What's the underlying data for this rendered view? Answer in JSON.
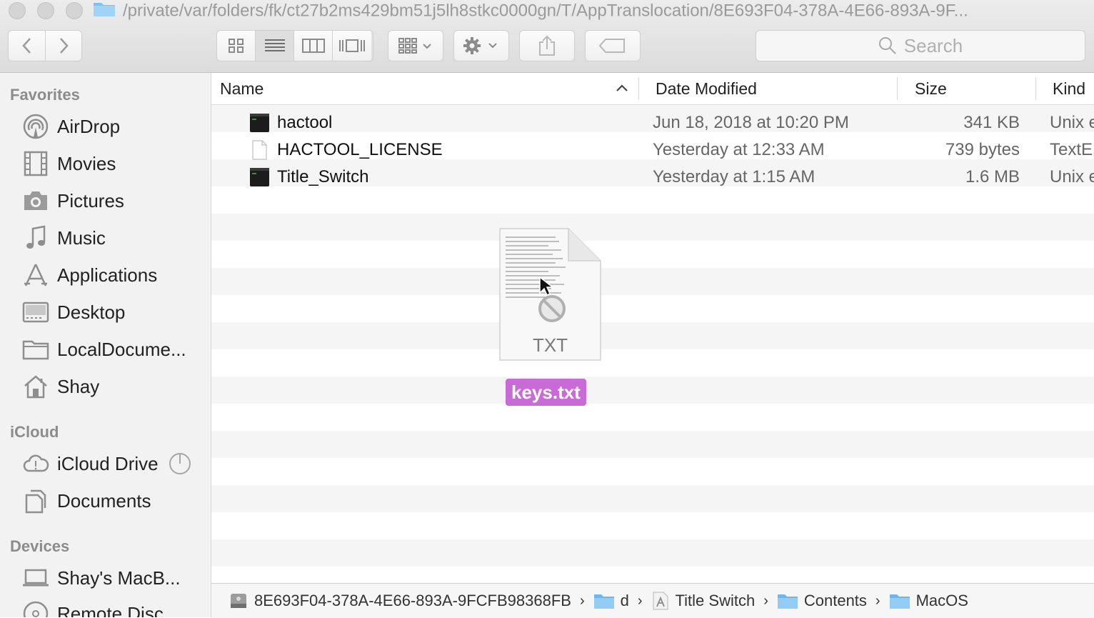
{
  "window": {
    "title_path": "/private/var/folders/fk/ct27b2ms429bm51j5lh8stkc0000gn/T/AppTranslocation/8E693F04-378A-4E66-893A-9F..."
  },
  "toolbar": {
    "search_placeholder": "Search"
  },
  "sidebar": {
    "favorites_header": "Favorites",
    "favorites": [
      {
        "label": "AirDrop",
        "icon": "airdrop-icon"
      },
      {
        "label": "Movies",
        "icon": "film-icon"
      },
      {
        "label": "Pictures",
        "icon": "camera-icon"
      },
      {
        "label": "Music",
        "icon": "music-note-icon"
      },
      {
        "label": "Applications",
        "icon": "applications-icon"
      },
      {
        "label": "Desktop",
        "icon": "desktop-icon"
      },
      {
        "label": "LocalDocume...",
        "icon": "folder-icon"
      },
      {
        "label": "Shay",
        "icon": "home-icon"
      }
    ],
    "icloud_header": "iCloud",
    "icloud": [
      {
        "label": "iCloud Drive",
        "icon": "cloud-icon"
      },
      {
        "label": "Documents",
        "icon": "documents-icon"
      }
    ],
    "devices_header": "Devices",
    "devices": [
      {
        "label": "Shay's MacB...",
        "icon": "laptop-icon"
      },
      {
        "label": "Remote Disc",
        "icon": "disc-icon"
      }
    ]
  },
  "columns": {
    "name": "Name",
    "date": "Date Modified",
    "size": "Size",
    "kind": "Kind"
  },
  "files": [
    {
      "name": "hactool",
      "date": "Jun 18, 2018 at 10:20 PM",
      "size": "341 KB",
      "kind": "Unix e",
      "icon": "terminal-exec-icon"
    },
    {
      "name": "HACTOOL_LICENSE",
      "date": "Yesterday at 12:33 AM",
      "size": "739 bytes",
      "kind": "TextE",
      "icon": "text-document-icon"
    },
    {
      "name": "Title_Switch",
      "date": "Yesterday at 1:15 AM",
      "size": "1.6 MB",
      "kind": "Unix e",
      "icon": "terminal-exec-icon"
    }
  ],
  "drag": {
    "file_type": "TXT",
    "file_name": "keys.txt",
    "badge_color": "#c86bd6"
  },
  "pathbar": [
    {
      "label": "8E693F04-378A-4E66-893A-9FCFB98368FB",
      "icon": "disk-image-icon"
    },
    {
      "label": "d",
      "icon": "folder-icon"
    },
    {
      "label": "Title Switch",
      "icon": "app-icon"
    },
    {
      "label": "Contents",
      "icon": "folder-icon"
    },
    {
      "label": "MacOS",
      "icon": "folder-icon"
    }
  ]
}
